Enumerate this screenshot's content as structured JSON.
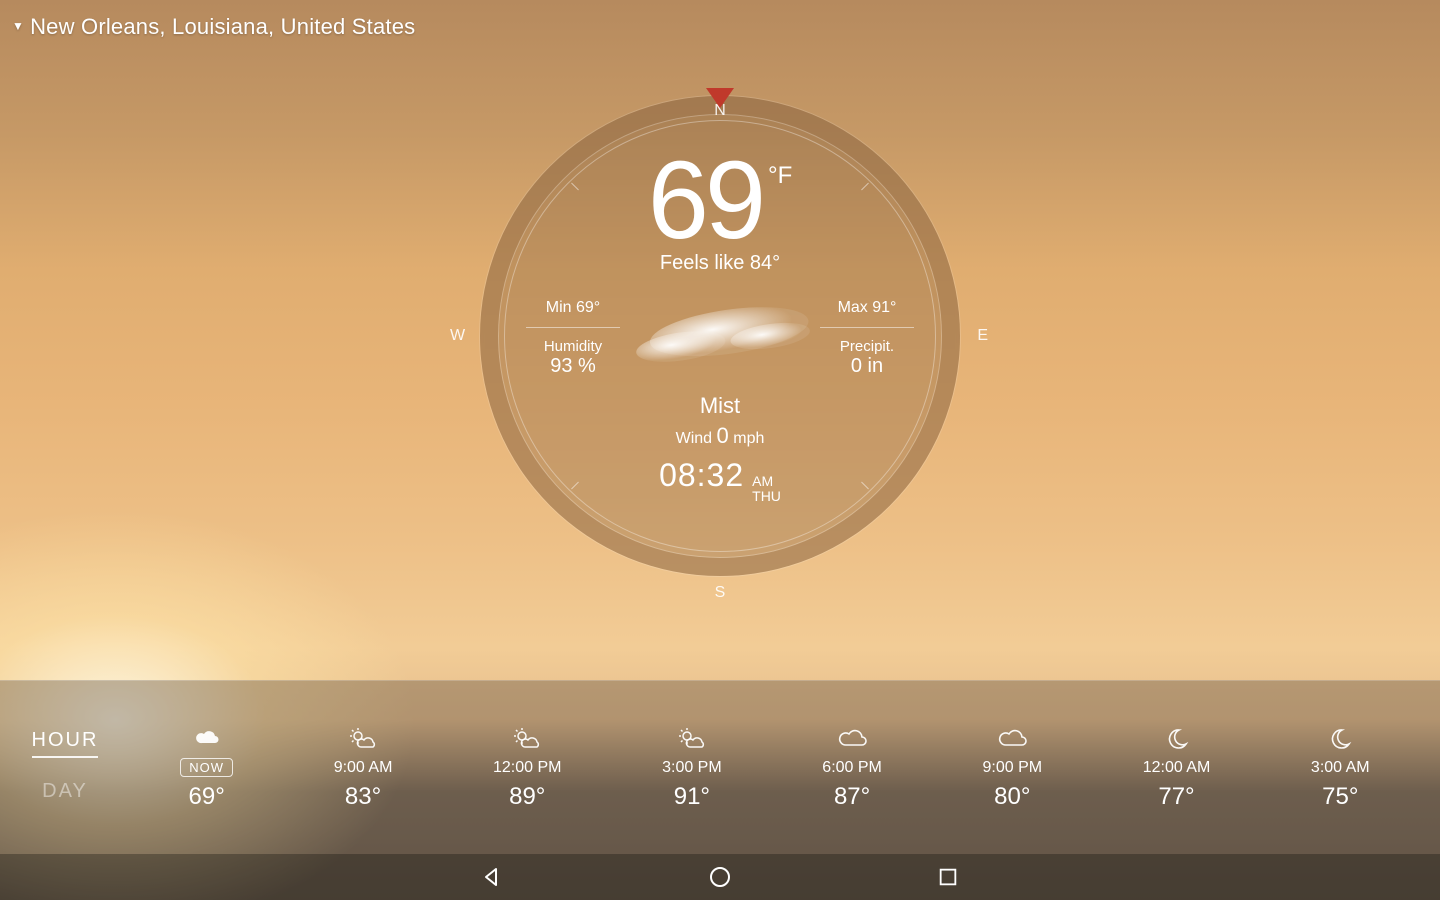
{
  "location": {
    "name": "New Orleans, Louisiana, United States"
  },
  "compass": {
    "n": "N",
    "s": "S",
    "e": "E",
    "w": "W"
  },
  "current": {
    "temp": "69",
    "unit": "°F",
    "feels_like": "Feels like 84°",
    "min_label": "Min 69°",
    "max_label": "Max 91°",
    "humidity_label": "Humidity",
    "humidity_value": "93 %",
    "precip_label": "Precipit.",
    "precip_value": "0 in",
    "condition": "Mist",
    "wind_label": "Wind",
    "wind_value": "0",
    "wind_unit": "mph",
    "time": "08:32",
    "ampm": "AM",
    "day": "THU"
  },
  "tabs": {
    "hour": "HOUR",
    "day": "DAY"
  },
  "hourly": [
    {
      "icon": "cloud-small",
      "time": "NOW",
      "temp": "69°",
      "now": true
    },
    {
      "icon": "partly",
      "time": "9:00 AM",
      "temp": "83°"
    },
    {
      "icon": "partly",
      "time": "12:00 PM",
      "temp": "89°"
    },
    {
      "icon": "partly",
      "time": "3:00 PM",
      "temp": "91°"
    },
    {
      "icon": "cloudy",
      "time": "6:00 PM",
      "temp": "87°"
    },
    {
      "icon": "cloudy",
      "time": "9:00 PM",
      "temp": "80°"
    },
    {
      "icon": "moon",
      "time": "12:00 AM",
      "temp": "77°"
    },
    {
      "icon": "moon",
      "time": "3:00 AM",
      "temp": "75°"
    }
  ]
}
